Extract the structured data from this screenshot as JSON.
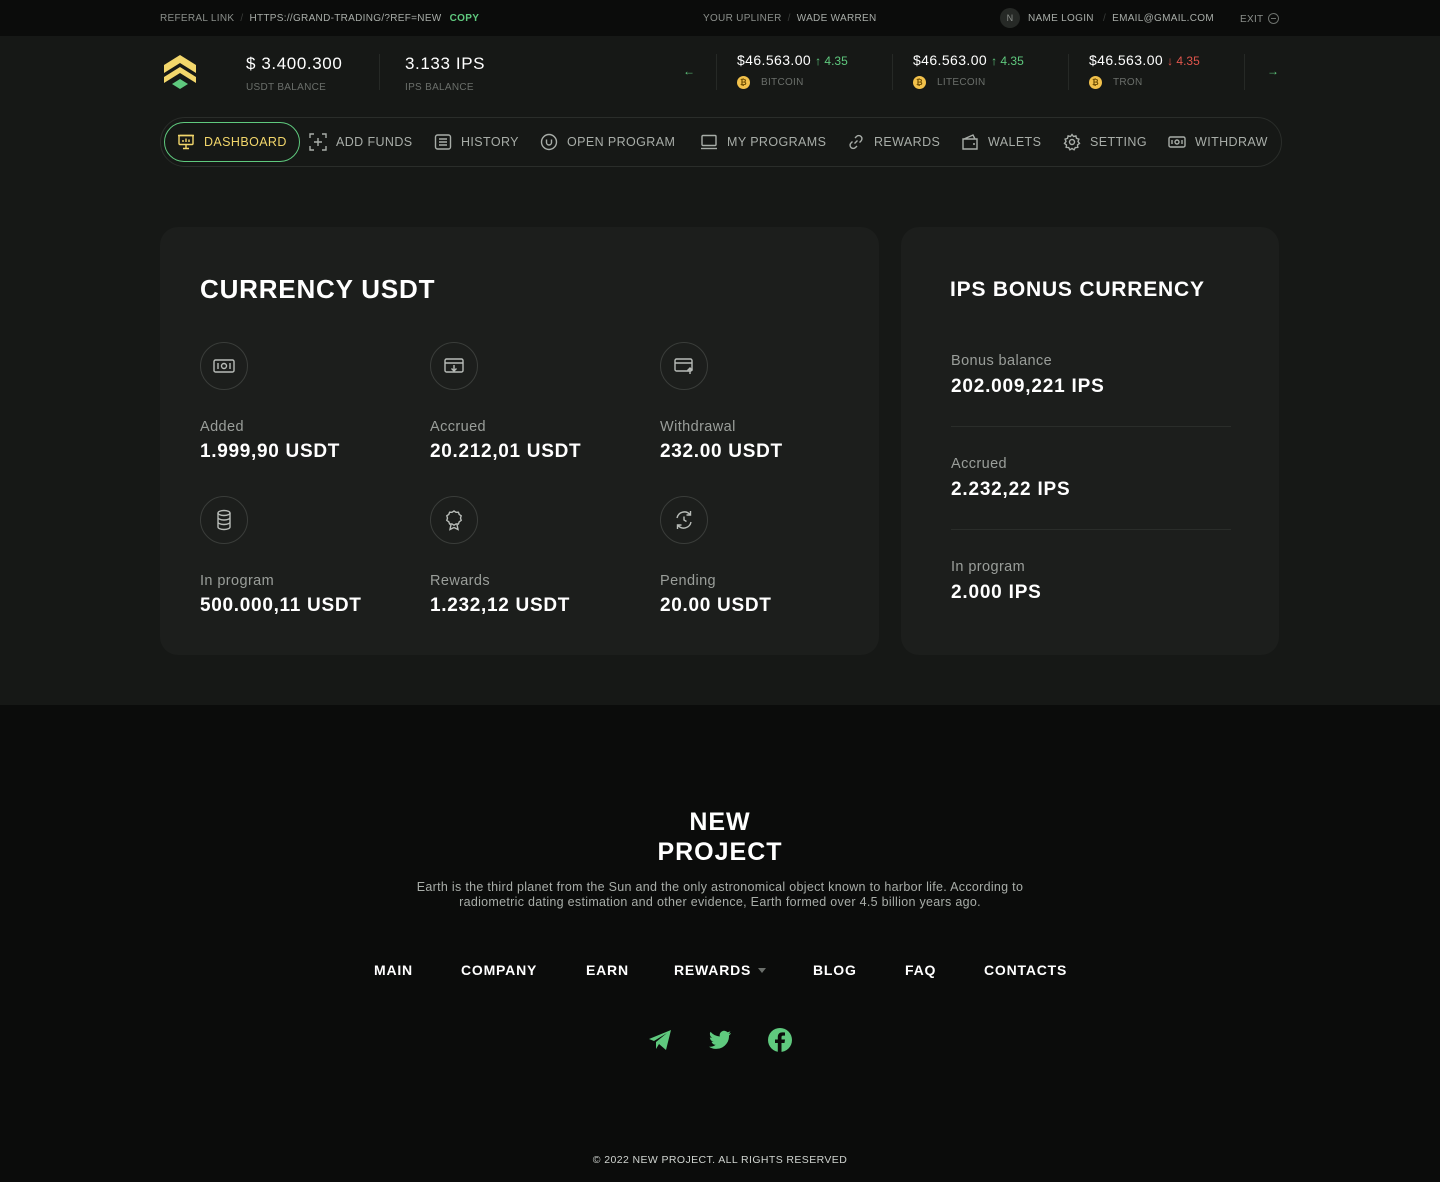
{
  "topbar": {
    "referral_label": "REFERAL LINK",
    "referral_url": "HTTPS://GRAND-TRADING/?REF=NEW",
    "copy_label": "COPY",
    "upliner_label": "YOUR UPLINER",
    "upliner_name": "WADE WARREN",
    "avatar_initial": "N",
    "login_name": "NAME LOGIN",
    "email": "EMAIL@GMAIL.COM",
    "exit_label": "EXIT"
  },
  "balances": {
    "usdt_value": "$ 3.400.300",
    "usdt_label": "USDT BALANCE",
    "ips_value": "3.133 IPS",
    "ips_label": "IPS BALANCE"
  },
  "tickers": [
    {
      "price": "$46.563.00",
      "change": "4.35",
      "direction": "up",
      "coin": "BITCOIN"
    },
    {
      "price": "$46.563.00",
      "change": "4.35",
      "direction": "up",
      "coin": "LITECOIN"
    },
    {
      "price": "$46.563.00",
      "change": "4.35",
      "direction": "down",
      "coin": "TRON"
    }
  ],
  "nav": {
    "items": [
      "DASHBOARD",
      "ADD FUNDS",
      "HISTORY",
      "OPEN PROGRAM",
      "MY PROGRAMS",
      "REWARDS",
      "WALETS",
      "SETTING",
      "WITHDRAW"
    ],
    "active": "DASHBOARD"
  },
  "currency_usdt": {
    "title": "CURRENCY USDT",
    "stats": [
      {
        "label": "Added",
        "value": "1.999,90 USDT",
        "icon": "cash-icon"
      },
      {
        "label": "Accrued",
        "value": "20.212,01 USDT",
        "icon": "deposit-icon"
      },
      {
        "label": "Withdrawal",
        "value": "232.00 USDT",
        "icon": "card-upload-icon"
      },
      {
        "label": "In program",
        "value": "500.000,11 USDT",
        "icon": "database-icon"
      },
      {
        "label": "Rewards",
        "value": "1.232,12 USDT",
        "icon": "award-icon"
      },
      {
        "label": "Pending",
        "value": "20.00 USDT",
        "icon": "refresh-icon"
      }
    ]
  },
  "ips_bonus": {
    "title": "IPS BONUS CURRENCY",
    "rows": [
      {
        "label": "Bonus balance",
        "value": "202.009,221 IPS"
      },
      {
        "label": "Accrued",
        "value": "2.232,22 IPS"
      },
      {
        "label": "In program",
        "value": "2.000 IPS"
      }
    ]
  },
  "footer": {
    "title_line1": "NEW",
    "title_line2": "PROJECT",
    "description_line1": "Earth is the third planet from the Sun and the only astronomical object known to harbor life. According to",
    "description_line2": "radiometric dating estimation and other evidence, Earth formed over 4.5 billion years ago.",
    "menu": [
      "MAIN",
      "COMPANY",
      "EARN",
      "REWARDS",
      "BLOG",
      "FAQ",
      "CONTACTS"
    ],
    "copyright": "© 2022 NEW PROJECT. ALL RIGHTS RESERVED"
  },
  "colors": {
    "accent_green": "#5fc97e",
    "accent_yellow": "#f2d66b",
    "down_red": "#e0554c",
    "background": "#161816",
    "card": "#1c1e1c"
  }
}
